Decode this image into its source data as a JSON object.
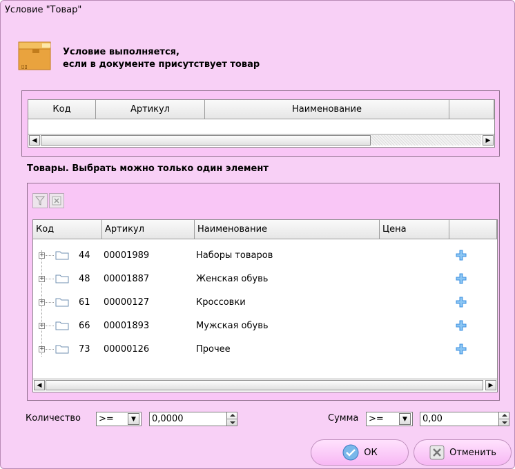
{
  "window": {
    "title": "Условие \"Товар\""
  },
  "header": {
    "line1": "Условие выполняется,",
    "line2": "если в документе присутствует товар",
    "icon": "box-icon"
  },
  "selected_grid": {
    "columns": [
      "Код",
      "Артикул",
      "Наименование",
      ""
    ]
  },
  "products": {
    "title": "Товары. Выбрать можно только один элемент",
    "toolbar": {
      "filter_icon": "filter-icon",
      "clear_icon": "clear-filter-icon"
    },
    "columns": [
      "Код",
      "Артикул",
      "Наименование",
      "Цена",
      ""
    ],
    "rows": [
      {
        "code": "44",
        "article": "00001989",
        "name": "Наборы товаров"
      },
      {
        "code": "48",
        "article": "00001887",
        "name": "Женская обувь"
      },
      {
        "code": "61",
        "article": "00000127",
        "name": "Кроссовки"
      },
      {
        "code": "66",
        "article": "00001893",
        "name": "Мужская обувь"
      },
      {
        "code": "73",
        "article": "00000126",
        "name": "Прочее"
      }
    ]
  },
  "footer": {
    "qty_label": "Количество",
    "qty_op": ">=",
    "qty_value": "0,0000",
    "sum_label": "Сумма",
    "sum_op": ">=",
    "sum_value": "0,00"
  },
  "buttons": {
    "ok": "ОК",
    "cancel": "Отменить"
  },
  "colors": {
    "window_bg": "#f8d0f6",
    "add_icon": "#3a8fe0"
  }
}
